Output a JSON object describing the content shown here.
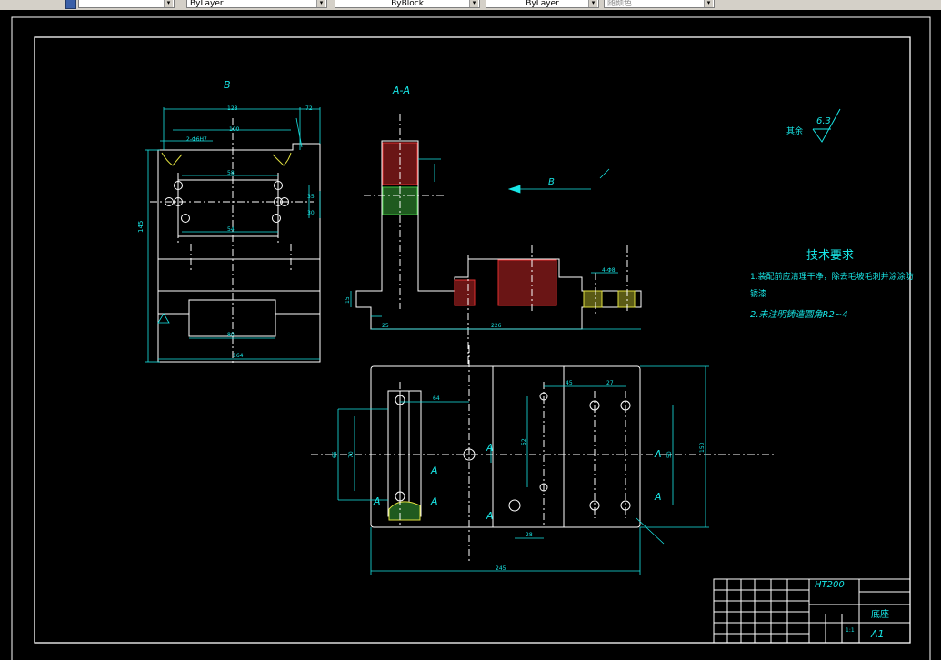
{
  "toolbar": {
    "layer_value": "",
    "linetype_value": "ByLayer",
    "lineweight_value": "ByBlock",
    "color_value": "ByLayer",
    "plotstyle_value": "随颜色"
  },
  "colors": {
    "background": "#000000",
    "line": "#18e6e6",
    "centerline": "#ffffff",
    "hatch": "#e03030",
    "hatch2": "#40c040",
    "frame": "#ffffff"
  },
  "views": {
    "view_b_label": "B",
    "section_label": "A-A",
    "arrow_label": "B",
    "section_marks": [
      "A",
      "A",
      "A",
      "A",
      "A",
      "A",
      "A"
    ]
  },
  "roughness": {
    "prefix": "其余",
    "value": "6.3"
  },
  "requirements": {
    "title": "技术要求",
    "line1": "1.装配前应清理干净，除去毛坡毛刺并涂涂防",
    "line1b": "锈漆",
    "line2": "2.未注明铸造圆角R2~4"
  },
  "dimensions": {
    "b_top": "128",
    "b_top2": "72",
    "b_mid": "100",
    "b_holes": "2-Φ6H7",
    "b_inner": "58",
    "b_inner2": "54",
    "b_height": "145",
    "b_bottom": "80",
    "b_total": "164",
    "b_right1": "35",
    "b_right2": "30",
    "a_width": "226",
    "a_left": "25",
    "a_base": "15",
    "a_hole": "4-Φ8",
    "plan_64": "64",
    "plan_45": "45",
    "plan_27": "27",
    "plan_26": "28",
    "plan_total": "245",
    "plan_height": "150",
    "plan_left": "66",
    "plan_left2": "70",
    "plan_mid": "52",
    "plan_r": "50"
  },
  "title_block": {
    "material": "HT200",
    "part_name": "底座",
    "sheet": "A1",
    "scale": "1:1"
  }
}
